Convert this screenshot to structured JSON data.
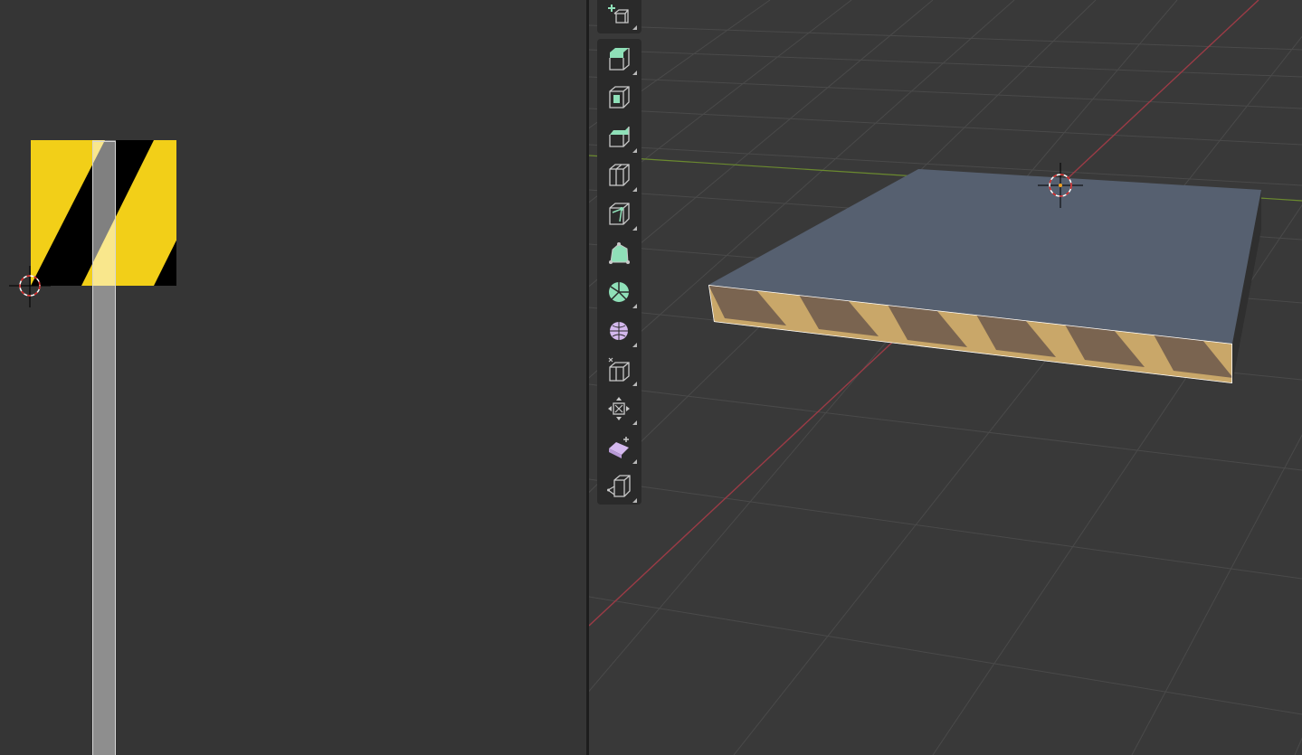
{
  "app": {
    "left_editor": "uv-editor",
    "right_editor": "3d-viewport"
  },
  "colors": {
    "editor_bg": "#353535",
    "viewport_bg": "#393939",
    "toolbar_bg": "#2a2a2a",
    "grid_line": "#4a4a4a",
    "x_axis": "#9b3b46",
    "y_axis": "#6b8a2f",
    "stripe_yellow": "#f2cf18",
    "stripe_black": "#000000",
    "top_face": "#566070",
    "mesh_edit_icon": "#8fe0b8",
    "generic_icon": "#c9c9c9",
    "selection_white": "#ffffff"
  },
  "toolbar": {
    "tools": [
      {
        "name": "add-cube-icon",
        "group": 0
      },
      {
        "name": "extrude-region-icon",
        "group": 1
      },
      {
        "name": "inset-faces-icon",
        "group": 1
      },
      {
        "name": "bevel-icon",
        "group": 1
      },
      {
        "name": "loop-cut-icon",
        "group": 1
      },
      {
        "name": "knife-icon",
        "group": 1
      },
      {
        "name": "poly-build-icon",
        "group": 1
      },
      {
        "name": "spin-icon",
        "group": 1
      },
      {
        "name": "smooth-vertices-icon",
        "group": 1
      },
      {
        "name": "edge-slide-icon",
        "group": 1
      },
      {
        "name": "shrink-fatten-icon",
        "group": 1
      },
      {
        "name": "shear-icon",
        "group": 1
      },
      {
        "name": "rip-region-icon",
        "group": 1
      }
    ]
  },
  "uv_editor": {
    "cursor": "2d-cursor-icon",
    "texture": "hazard-stripe-texture"
  },
  "viewport": {
    "cursor": "3d-cursor-icon",
    "object": "hazard-stripe-slab"
  }
}
